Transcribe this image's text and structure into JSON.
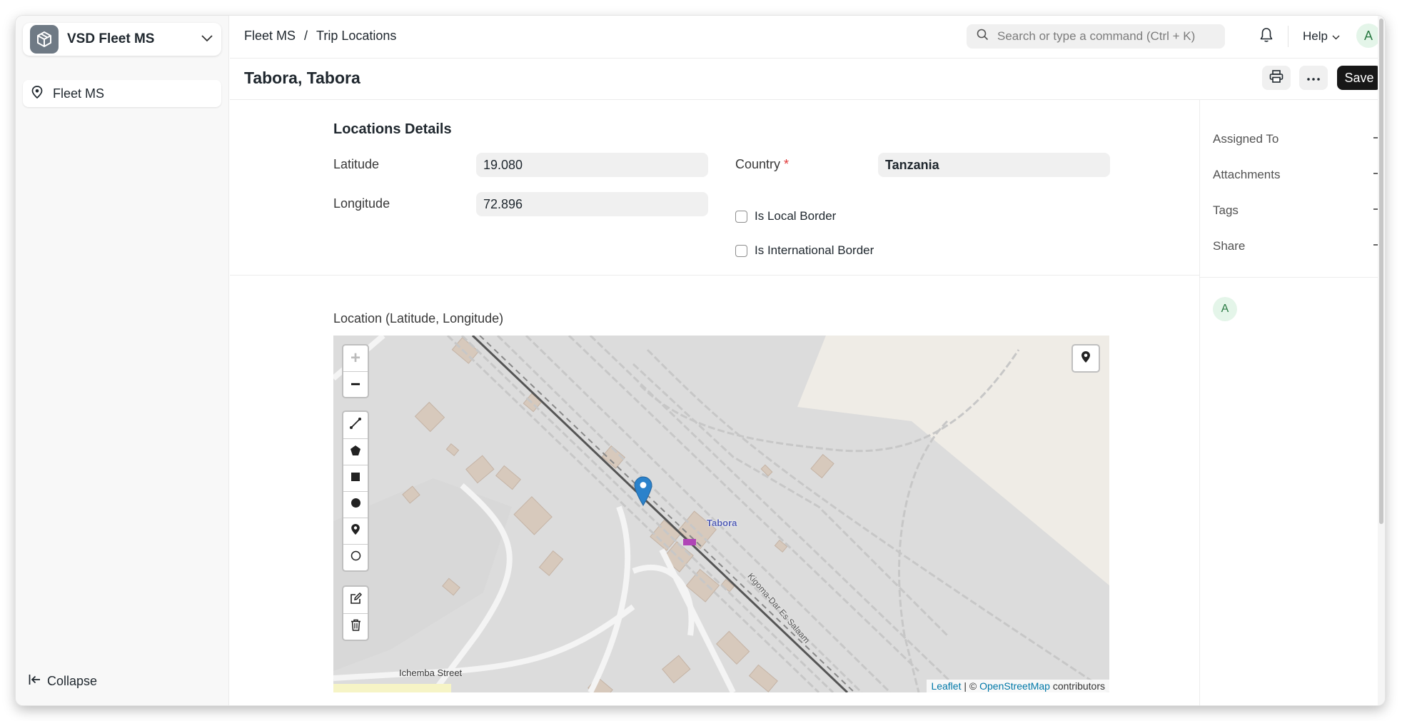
{
  "sidebar": {
    "app_name": "VSD Fleet MS",
    "items": [
      {
        "label": "Fleet MS",
        "icon": "location-pin-icon"
      }
    ],
    "collapse_label": "Collapse"
  },
  "topbar": {
    "breadcrumb": [
      "Fleet MS",
      "/",
      "Trip Locations"
    ],
    "search_placeholder": "Search or type a command (Ctrl + K)",
    "help_label": "Help",
    "avatar_initial": "A"
  },
  "page": {
    "title": "Tabora, Tabora",
    "save_label": "Save"
  },
  "form": {
    "section_title": "Locations Details",
    "latitude_label": "Latitude",
    "latitude_value": "19.080",
    "longitude_label": "Longitude",
    "longitude_value": "72.896",
    "country_label": "Country",
    "country_required": "*",
    "country_value": "Tanzania",
    "local_border_label": "Is Local Border",
    "international_border_label": "Is International Border",
    "map_label": "Location (Latitude, Longitude)"
  },
  "map": {
    "marker_label": "Tabora",
    "street_label": "Ichemba Street",
    "rail_label": "Kigoma-Dar Es Salaam",
    "zoom_in": "+",
    "zoom_out": "−",
    "attribution_leaflet": "Leaflet",
    "attribution_sep": " | © ",
    "attribution_osm": "OpenStreetMap",
    "attribution_suffix": " contributors"
  },
  "sidepanel": {
    "assigned_to": "Assigned To",
    "attachments": "Attachments",
    "tags": "Tags",
    "share": "Share",
    "avatar_initial": "A"
  },
  "colors": {
    "accent": "#171717",
    "marker": "#2b82cb",
    "avatar_bg": "#e4f5e9"
  }
}
